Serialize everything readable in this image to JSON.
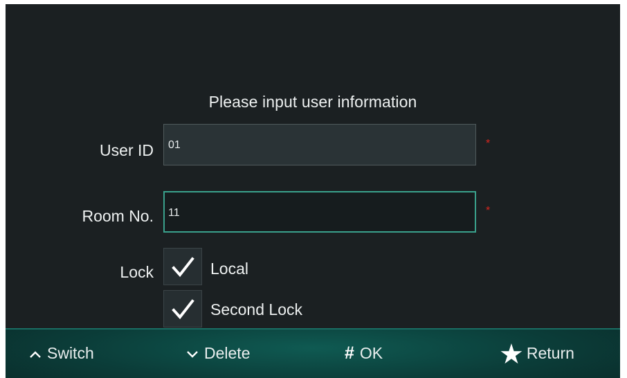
{
  "form": {
    "title": "Please input user information",
    "user_id": {
      "label": "User ID",
      "value": "01",
      "required_mark": "*"
    },
    "room_no": {
      "label": "Room No.",
      "value": "11",
      "required_mark": "*"
    },
    "lock": {
      "label": "Lock",
      "options": [
        {
          "label": "Local",
          "checked": true
        },
        {
          "label": "Second Lock",
          "checked": true
        }
      ]
    }
  },
  "footer": {
    "switch": {
      "icon": "caret-up-icon",
      "label": "Switch"
    },
    "delete": {
      "icon": "caret-down-icon",
      "label": "Delete"
    },
    "ok": {
      "icon": "hash-icon",
      "symbol": "#",
      "label": "OK"
    },
    "return": {
      "icon": "star-icon",
      "symbol": "★",
      "label": "Return"
    }
  },
  "colors": {
    "background": "#1b2022",
    "focus_border": "#3aa18c",
    "required": "#d8261e",
    "footer": "#0b3d39"
  }
}
